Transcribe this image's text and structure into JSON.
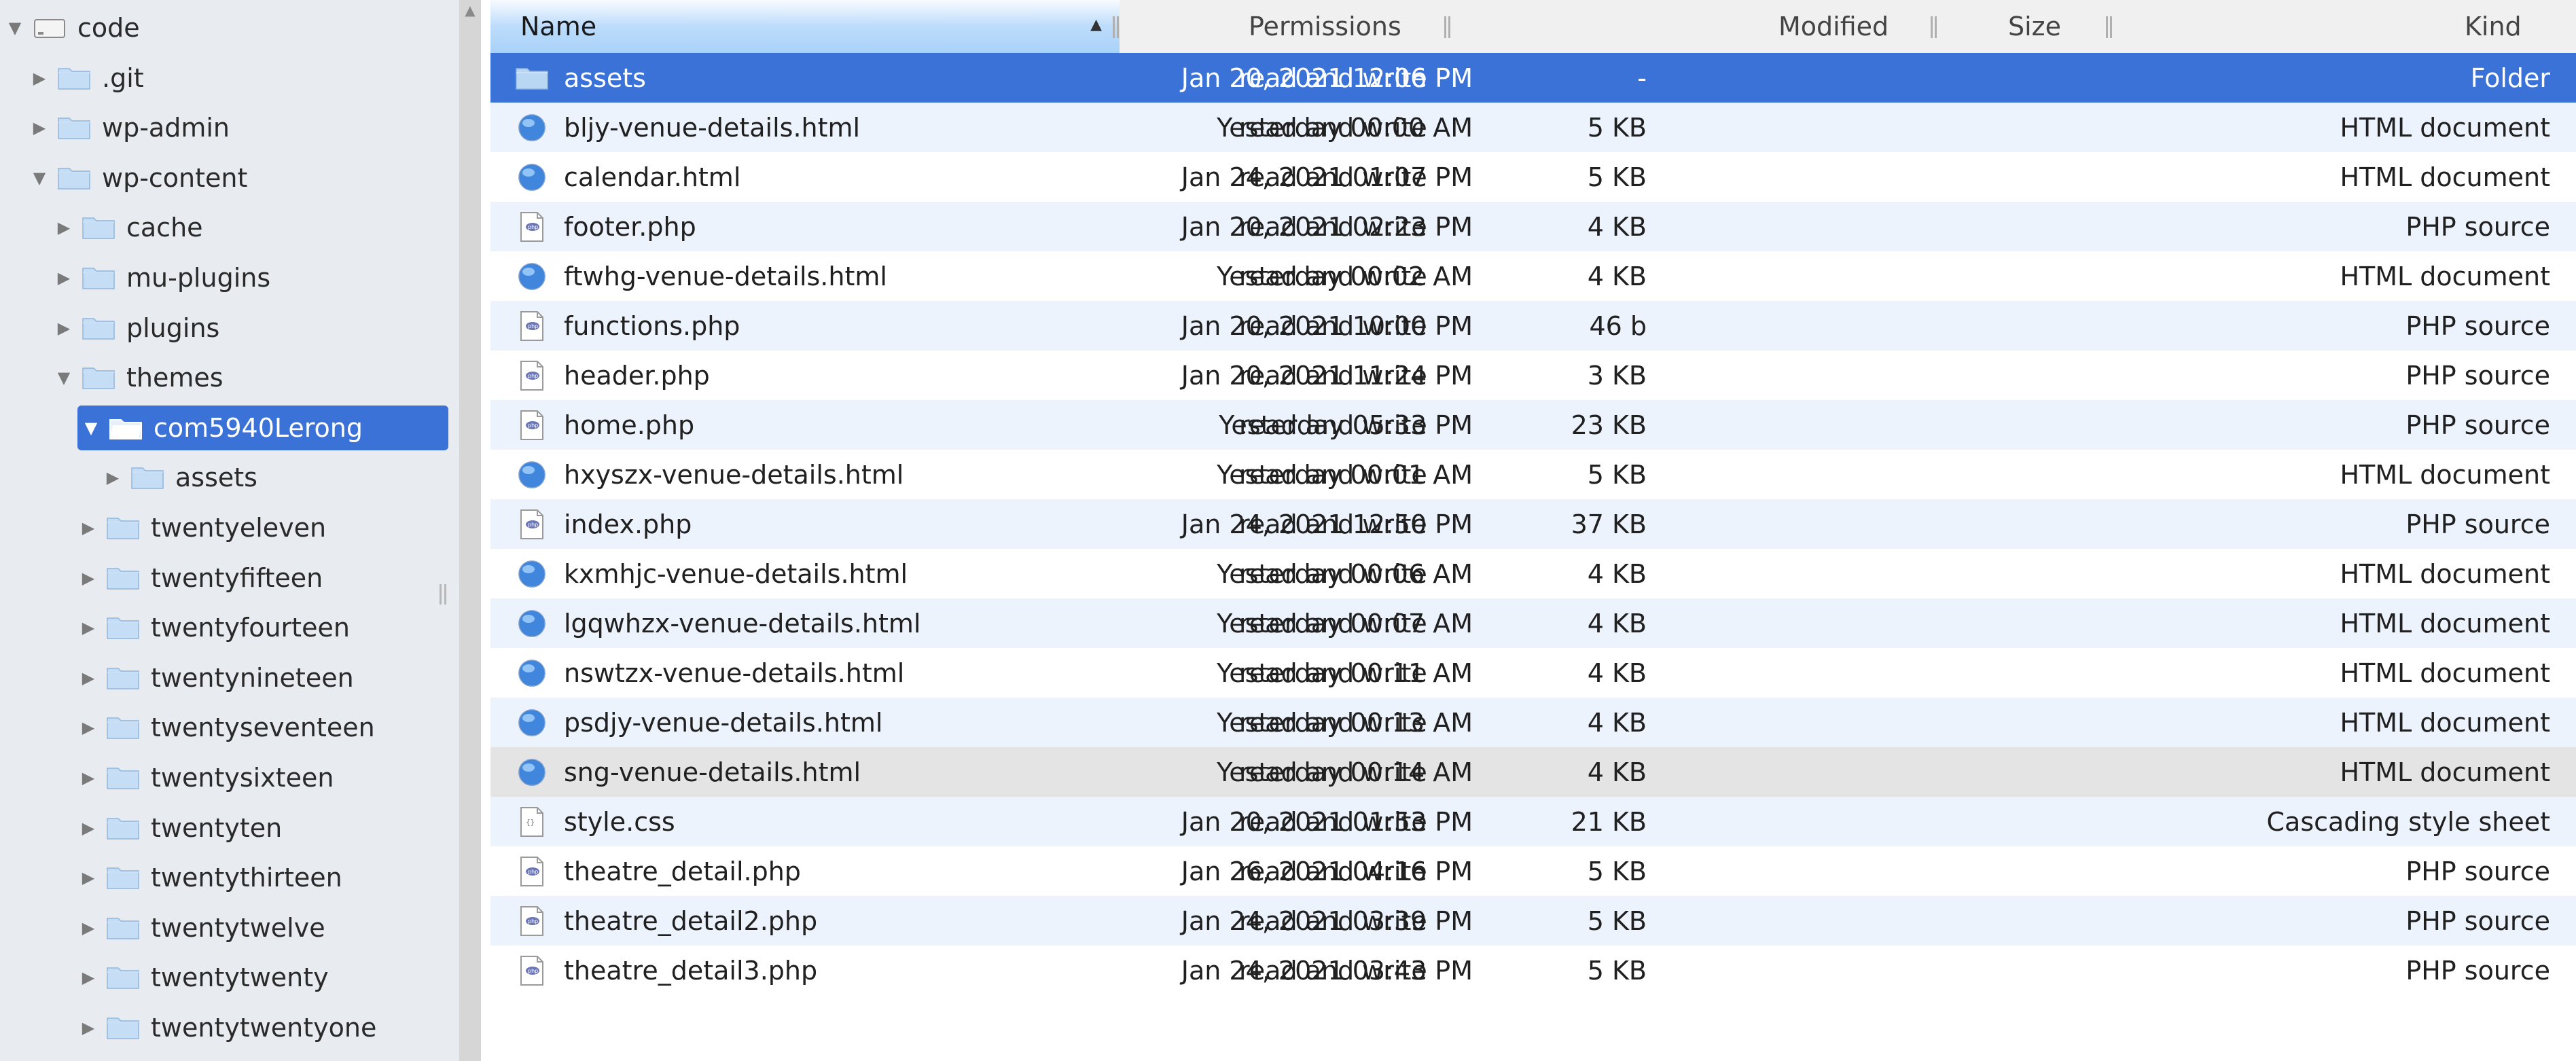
{
  "sidebar": {
    "items": [
      {
        "label": "code",
        "expanded": true,
        "icon": "drive-icon"
      },
      {
        "label": ".git",
        "expanded": false,
        "icon": "folder-icon"
      },
      {
        "label": "wp-admin",
        "expanded": false,
        "icon": "folder-icon"
      },
      {
        "label": "wp-content",
        "expanded": true,
        "icon": "folder-icon"
      },
      {
        "label": "cache",
        "expanded": false,
        "icon": "folder-icon"
      },
      {
        "label": "mu-plugins",
        "expanded": false,
        "icon": "folder-icon"
      },
      {
        "label": "plugins",
        "expanded": false,
        "icon": "folder-icon"
      },
      {
        "label": "themes",
        "expanded": true,
        "icon": "folder-icon"
      },
      {
        "label": "com5940Lerong",
        "expanded": true,
        "icon": "folder-open-icon",
        "selected": true
      },
      {
        "label": "assets",
        "expanded": false,
        "icon": "folder-icon"
      },
      {
        "label": "twentyeleven",
        "expanded": false,
        "icon": "folder-icon"
      },
      {
        "label": "twentyfifteen",
        "expanded": false,
        "icon": "folder-icon"
      },
      {
        "label": "twentyfourteen",
        "expanded": false,
        "icon": "folder-icon"
      },
      {
        "label": "twentynineteen",
        "expanded": false,
        "icon": "folder-icon"
      },
      {
        "label": "twentyseventeen",
        "expanded": false,
        "icon": "folder-icon"
      },
      {
        "label": "twentysixteen",
        "expanded": false,
        "icon": "folder-icon"
      },
      {
        "label": "twentyten",
        "expanded": false,
        "icon": "folder-icon"
      },
      {
        "label": "twentythirteen",
        "expanded": false,
        "icon": "folder-icon"
      },
      {
        "label": "twentytwelve",
        "expanded": false,
        "icon": "folder-icon"
      },
      {
        "label": "twentytwenty",
        "expanded": false,
        "icon": "folder-icon"
      },
      {
        "label": "twentytwentyone",
        "expanded": false,
        "icon": "folder-icon"
      }
    ]
  },
  "table": {
    "columns": {
      "name": "Name",
      "permissions": "Permissions",
      "modified": "Modified",
      "size": "Size",
      "kind": "Kind"
    },
    "rows": [
      {
        "name": "assets",
        "perm": "read and write",
        "modified": "Jan 20, 2021 12:06 PM",
        "size": "-",
        "kind": "Folder",
        "icon": "folder-icon",
        "state": "selected"
      },
      {
        "name": "bljy-venue-details.html",
        "perm": "read and write",
        "modified": "Yesterday 00:00 AM",
        "size": "5 KB",
        "kind": "HTML document",
        "icon": "html-globe-icon"
      },
      {
        "name": "calendar.html",
        "perm": "read and write",
        "modified": "Jan 24, 2021 01:07 PM",
        "size": "5 KB",
        "kind": "HTML document",
        "icon": "html-globe-icon"
      },
      {
        "name": "footer.php",
        "perm": "read and write",
        "modified": "Jan 20, 2021 02:23 PM",
        "size": "4 KB",
        "kind": "PHP source",
        "icon": "php-file-icon"
      },
      {
        "name": "ftwhg-venue-details.html",
        "perm": "read and write",
        "modified": "Yesterday 00:02 AM",
        "size": "4 KB",
        "kind": "HTML document",
        "icon": "html-globe-icon"
      },
      {
        "name": "functions.php",
        "perm": "read and write",
        "modified": "Jan 20, 2021 10:00 PM",
        "size": "46 b",
        "kind": "PHP source",
        "icon": "php-file-icon"
      },
      {
        "name": "header.php",
        "perm": "read and write",
        "modified": "Jan 20, 2021 11:24 PM",
        "size": "3 KB",
        "kind": "PHP source",
        "icon": "php-file-icon"
      },
      {
        "name": "home.php",
        "perm": "read and write",
        "modified": "Yesterday 05:33 PM",
        "size": "23 KB",
        "kind": "PHP source",
        "icon": "php-file-icon"
      },
      {
        "name": "hxyszx-venue-details.html",
        "perm": "read and write",
        "modified": "Yesterday 00:01 AM",
        "size": "5 KB",
        "kind": "HTML document",
        "icon": "html-globe-icon"
      },
      {
        "name": "index.php",
        "perm": "read and write",
        "modified": "Jan 24, 2021 12:50 PM",
        "size": "37 KB",
        "kind": "PHP source",
        "icon": "php-file-icon"
      },
      {
        "name": "kxmhjc-venue-details.html",
        "perm": "read and write",
        "modified": "Yesterday 00:06 AM",
        "size": "4 KB",
        "kind": "HTML document",
        "icon": "html-globe-icon"
      },
      {
        "name": "lgqwhzx-venue-details.html",
        "perm": "read and write",
        "modified": "Yesterday 00:07 AM",
        "size": "4 KB",
        "kind": "HTML document",
        "icon": "html-globe-icon"
      },
      {
        "name": "nswtzx-venue-details.html",
        "perm": "read and write",
        "modified": "Yesterday 00:11 AM",
        "size": "4 KB",
        "kind": "HTML document",
        "icon": "html-globe-icon"
      },
      {
        "name": "psdjy-venue-details.html",
        "perm": "read and write",
        "modified": "Yesterday 00:13 AM",
        "size": "4 KB",
        "kind": "HTML document",
        "icon": "html-globe-icon"
      },
      {
        "name": "sng-venue-details.html",
        "perm": "read and write",
        "modified": "Yesterday 00:14 AM",
        "size": "4 KB",
        "kind": "HTML document",
        "icon": "html-globe-icon",
        "state": "hover"
      },
      {
        "name": "style.css",
        "perm": "read and write",
        "modified": "Jan 20, 2021 01:53 PM",
        "size": "21 KB",
        "kind": "Cascading style sheet",
        "icon": "css-file-icon"
      },
      {
        "name": "theatre_detail.php",
        "perm": "read and write",
        "modified": "Jan 26, 2021 04:16 PM",
        "size": "5 KB",
        "kind": "PHP source",
        "icon": "php-file-icon"
      },
      {
        "name": "theatre_detail2.php",
        "perm": "read and write",
        "modified": "Jan 24, 2021 03:39 PM",
        "size": "5 KB",
        "kind": "PHP source",
        "icon": "php-file-icon"
      },
      {
        "name": "theatre_detail3.php",
        "perm": "read and write",
        "modified": "Jan 24, 2021 03:43 PM",
        "size": "5 KB",
        "kind": "PHP source",
        "icon": "php-file-icon"
      }
    ]
  },
  "colors": {
    "selection": "#3a72d8",
    "folder": "#a9cff2",
    "stripe": "#edf3fd",
    "sidebar_bg": "#e8ecf1"
  }
}
